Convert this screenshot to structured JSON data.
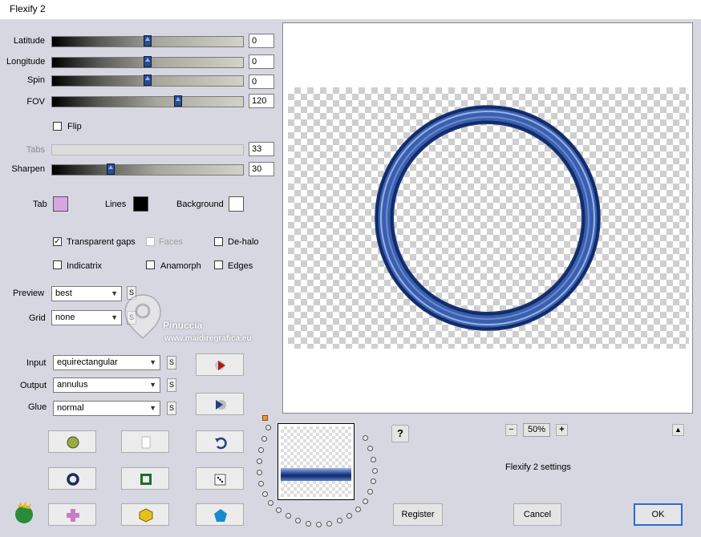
{
  "window": {
    "title": "Flexify 2"
  },
  "sliders": [
    {
      "id": "latitude",
      "label": "Latitude",
      "value": "0",
      "level": 0.5,
      "enabled": true
    },
    {
      "id": "longitude",
      "label": "Longitude",
      "value": "0",
      "level": 0.5,
      "enabled": true
    },
    {
      "id": "spin",
      "label": "Spin",
      "value": "0",
      "level": 0.5,
      "enabled": true
    },
    {
      "id": "fov",
      "label": "FOV",
      "value": "120",
      "level": 0.66,
      "enabled": true
    },
    {
      "id": "tabs",
      "label": "Tabs",
      "value": "33",
      "level": null,
      "enabled": false
    },
    {
      "id": "sharpen",
      "label": "Sharpen",
      "value": "30",
      "level": 0.3,
      "enabled": true
    }
  ],
  "flip": {
    "label": "Flip",
    "checked": false
  },
  "colors": {
    "tab": {
      "label": "Tab",
      "color": "#d7a5e3"
    },
    "lines": {
      "label": "Lines",
      "color": "#000000"
    },
    "background": {
      "label": "Background",
      "color": "#ffffff"
    }
  },
  "options": {
    "transparent_gaps": {
      "label": "Transparent gaps",
      "checked": true
    },
    "faces": {
      "label": "Faces",
      "checked": false,
      "enabled": false
    },
    "de_halo": {
      "label": "De-halo",
      "checked": false
    },
    "indicatrix": {
      "label": "Indicatrix",
      "checked": false
    },
    "anamorph": {
      "label": "Anamorph",
      "checked": false
    },
    "edges": {
      "label": "Edges",
      "checked": false
    }
  },
  "preview_select": {
    "label": "Preview",
    "value": "best"
  },
  "grid_select": {
    "label": "Grid",
    "value": "none"
  },
  "input_select": {
    "label": "Input",
    "value": "equirectangular"
  },
  "output_select": {
    "label": "Output",
    "value": "annulus"
  },
  "glue_select": {
    "label": "Glue",
    "value": "normal"
  },
  "s_label": "S",
  "zoom": {
    "value": "50%",
    "minus": "−",
    "plus": "+"
  },
  "settings_label": "Flexify 2 settings",
  "help_label": "?",
  "buttons": {
    "register": "Register",
    "cancel": "Cancel",
    "ok": "OK"
  },
  "watermark": {
    "name": "Pinuccia",
    "site": "www.maidiregrafica.eu"
  },
  "ring_color": "#3a5fae"
}
